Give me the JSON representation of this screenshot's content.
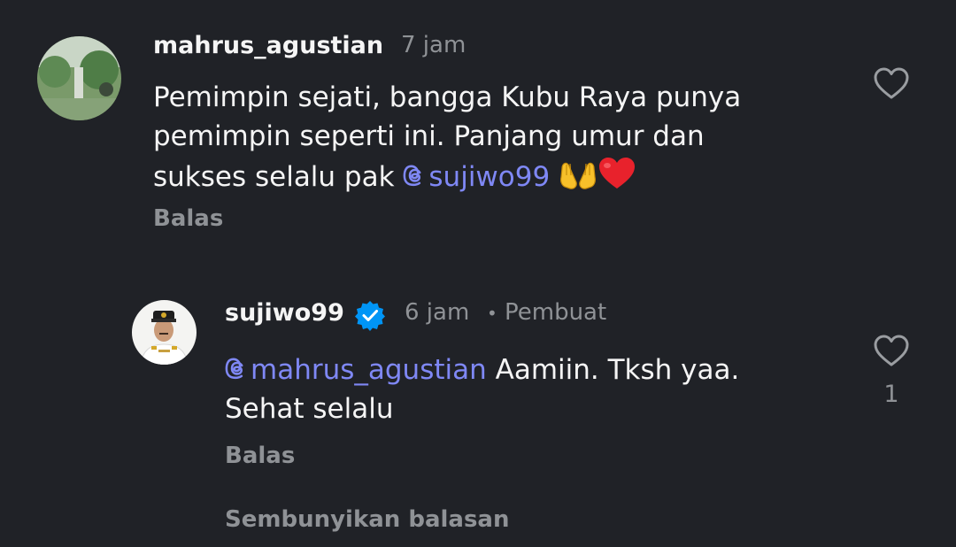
{
  "comment": {
    "username": "mahrus_agustian",
    "time": "7 jam",
    "text_line1": "Pemimpin sejati, bangga Kubu Raya punya",
    "text_line2": "pemimpin seperti ini. Panjang umur dan",
    "text_line3_prefix": "sukses selalu pak ",
    "mention": "sujiwo99",
    "emojis": [
      "palms-up-together",
      "red-heart"
    ],
    "reply_label": "Balas"
  },
  "reply": {
    "username": "sujiwo99",
    "verified": true,
    "time": "6 jam",
    "separator": "•",
    "author_tag": "Pembuat",
    "mention": "mahrus_agustian",
    "text_line1_suffix": " Aamiin. Tksh yaa.",
    "text_line2": "Sehat selalu",
    "reply_label": "Balas",
    "like_count": "1"
  },
  "hide_replies_label": "Sembunyikan balasan",
  "colors": {
    "background": "#202227",
    "mention": "#7f88f5",
    "muted": "#8f9296",
    "verified": "#0095f6"
  }
}
